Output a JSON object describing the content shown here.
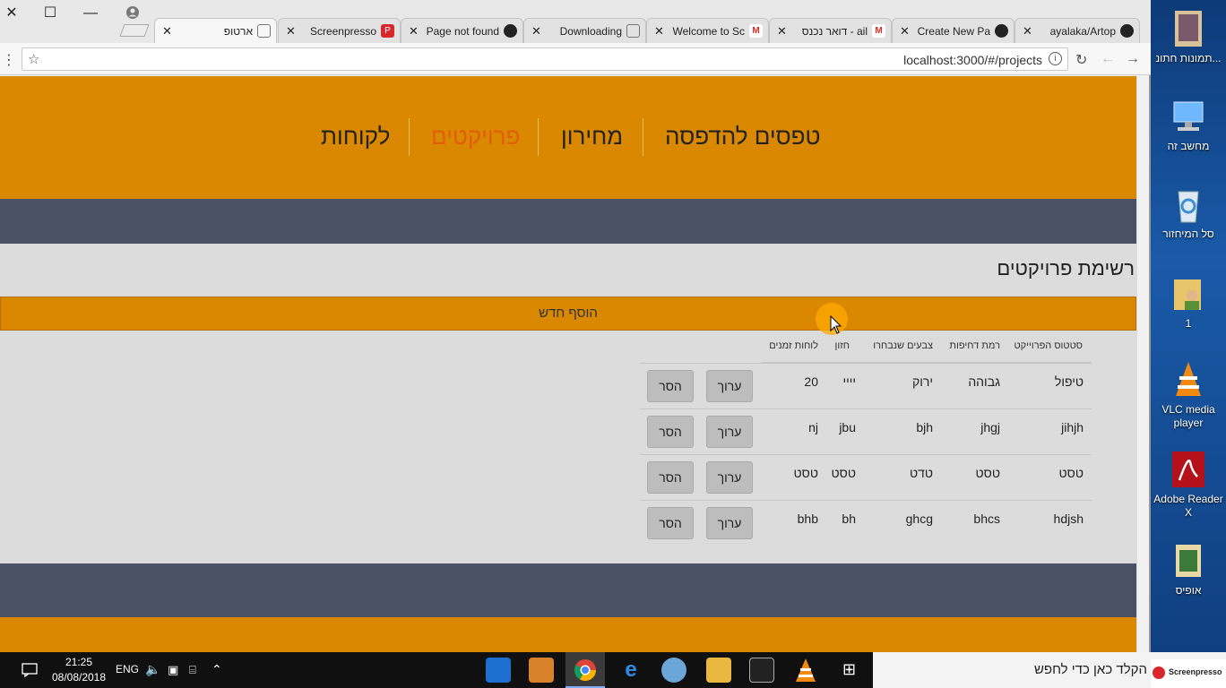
{
  "window": {
    "close_glyph": "✕",
    "maximize_glyph": "☐",
    "minimize_glyph": "—"
  },
  "tabs": [
    {
      "title": "ארטופ",
      "icon": "page-icon",
      "active": true
    },
    {
      "title": "Screenpresso",
      "icon": "screenpresso-icon"
    },
    {
      "title": "Page not found",
      "icon": "github-icon"
    },
    {
      "title": "Downloading",
      "icon": "page-icon"
    },
    {
      "title": "Welcome to Sc",
      "icon": "gmail-icon"
    },
    {
      "title": "דואר נכנס - ail",
      "icon": "gmail-icon"
    },
    {
      "title": "Create New Pa",
      "icon": "github-icon"
    },
    {
      "title": "ayalaka/Artop",
      "icon": "github-icon"
    }
  ],
  "address": {
    "url": "localhost:3000/#/projects"
  },
  "nav": {
    "items": [
      {
        "label": "טפסים להדפסה"
      },
      {
        "label": "מחירון"
      },
      {
        "label": "פרויקטים",
        "active": true
      },
      {
        "label": "לקוחות"
      }
    ]
  },
  "main": {
    "title": "רשימת פרויקטים",
    "add_button": "הוסף חדש",
    "headers": [
      "סטטוס הפרוייקט",
      "רמת דחיפות",
      "צבעים שנבחרו",
      "חזון",
      "לוחות זמנים"
    ],
    "edit_label": "ערוך",
    "remove_label": "הסר",
    "rows": [
      [
        "טיפול",
        "גבוהה",
        "ירוק",
        "יייי",
        "20"
      ],
      [
        "jihjh",
        "jhgj",
        "bjh",
        "jbu",
        "nj"
      ],
      [
        "טסט",
        "טסט",
        "טדט",
        "טסט",
        "טסט"
      ],
      [
        "hdjsh",
        "bhcs",
        "ghcg",
        "bh",
        "bhb"
      ]
    ]
  },
  "desktop": {
    "icons": [
      {
        "label": "תמונות חתונ...",
        "icon": "photo-folder-icon"
      },
      {
        "label": "מחשב זה",
        "icon": "computer-icon"
      },
      {
        "label": "סל המיחזור",
        "icon": "recycle-bin-icon"
      },
      {
        "label": "1",
        "icon": "user-folder-icon"
      },
      {
        "label": "VLC media player",
        "icon": "vlc-icon"
      },
      {
        "label": "Adobe Reader X",
        "icon": "adobe-reader-icon"
      },
      {
        "label": "אופיס",
        "icon": "office-folder-icon"
      }
    ]
  },
  "taskbar": {
    "time": "21:25",
    "date": "08/08/2018",
    "lang": "ENG",
    "search_text": "הקלד כאן כדי לחפש",
    "screenpresso_label": "Screenpresso"
  },
  "colors": {
    "brand_orange": "#d98800",
    "slate": "#4b5166",
    "active_nav": "#e25c0c"
  }
}
